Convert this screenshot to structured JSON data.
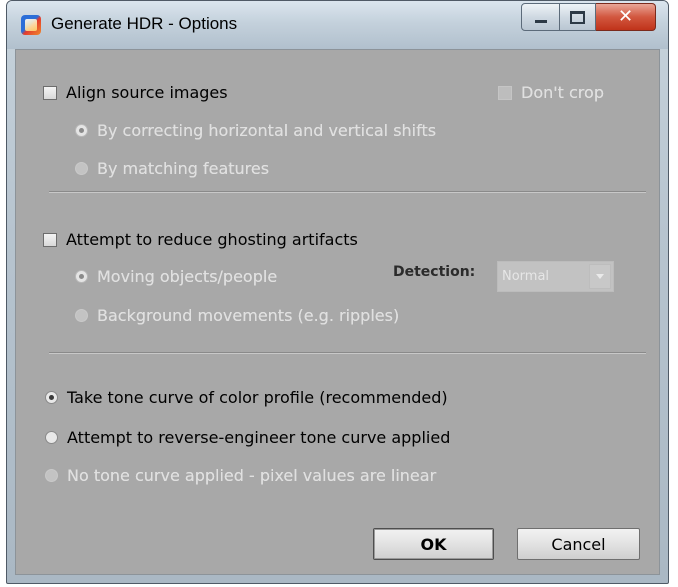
{
  "window": {
    "title": "Generate HDR - Options",
    "controls": {
      "minimize": "minimize",
      "maximize": "maximize",
      "close": "✕"
    }
  },
  "align": {
    "checkbox_label": "Align source images",
    "checked": false,
    "dont_crop_label": "Don't crop",
    "options": [
      {
        "label": "By correcting horizontal and vertical shifts",
        "selected": true,
        "enabled": false
      },
      {
        "label": "By matching features",
        "selected": false,
        "enabled": false
      }
    ]
  },
  "ghosting": {
    "checkbox_label": "Attempt to reduce ghosting artifacts",
    "checked": false,
    "options": [
      {
        "label": "Moving objects/people",
        "selected": true,
        "enabled": false
      },
      {
        "label": "Background movements (e.g. ripples)",
        "selected": false,
        "enabled": false
      }
    ],
    "detection_label": "Detection:",
    "detection_value": "Normal"
  },
  "tone_curve": {
    "options": [
      {
        "label": "Take tone curve of color profile (recommended)",
        "selected": true,
        "enabled": true
      },
      {
        "label": "Attempt to reverse-engineer tone curve applied",
        "selected": false,
        "enabled": true
      },
      {
        "label": "No tone curve applied - pixel values are linear",
        "selected": false,
        "enabled": false
      }
    ]
  },
  "buttons": {
    "ok": "OK",
    "cancel": "Cancel"
  }
}
